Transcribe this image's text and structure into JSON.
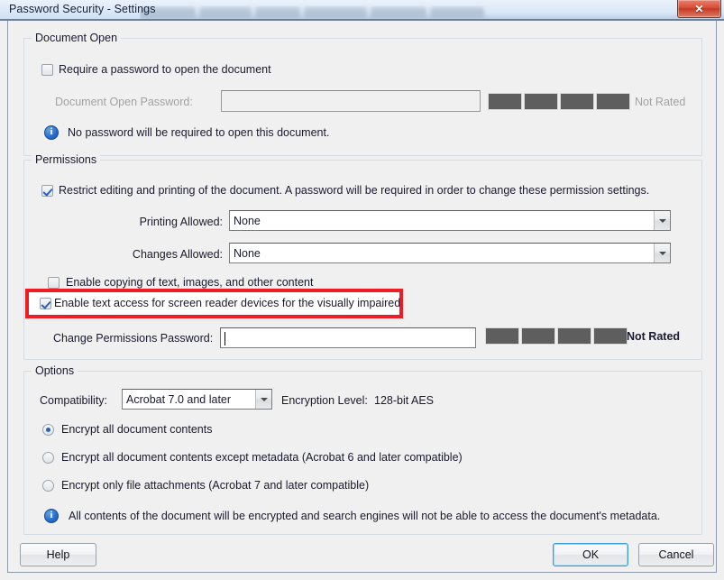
{
  "window": {
    "title": "Password Security - Settings",
    "close_label": "✕",
    "close_icon": "close-icon"
  },
  "document_open": {
    "group_title": "Document Open",
    "require_password_label": "Require a password to open the document",
    "require_password_checked": false,
    "password_field_label": "Document Open Password:",
    "password_field_value": "",
    "password_field_disabled": true,
    "strength_label": "Not Rated",
    "strength_segments": 4,
    "info_icon": "info-icon",
    "info_text": "No password will be required to open this document."
  },
  "permissions": {
    "group_title": "Permissions",
    "restrict_label": "Restrict editing and printing of the document. A password will be required in order to change these permission settings.",
    "restrict_checked": true,
    "printing_label": "Printing Allowed:",
    "printing_value": "None",
    "changes_label": "Changes Allowed:",
    "changes_value": "None",
    "enable_copy_label": "Enable copying of text, images, and other content",
    "enable_copy_checked": false,
    "screen_reader_label": "Enable text access for screen reader devices for the visually impaired",
    "screen_reader_checked": true,
    "change_password_label": "Change Permissions Password:",
    "change_password_value": "",
    "strength_label": "Not Rated",
    "strength_segments": 4
  },
  "options": {
    "group_title": "Options",
    "compatibility_label": "Compatibility:",
    "compatibility_value": "Acrobat 7.0 and later",
    "encryption_level_label": "Encryption Level:",
    "encryption_level_value": "128-bit AES",
    "radio_all_contents": "Encrypt all document contents",
    "radio_except_metadata": "Encrypt all document contents except metadata (Acrobat 6 and later compatible)",
    "radio_only_attachments": "Encrypt only file attachments (Acrobat 7 and later compatible)",
    "selected_radio": "all_contents",
    "info_icon": "info-icon",
    "info_text": "All contents of the document will be encrypted and search engines will not be able to access the document's metadata."
  },
  "footer": {
    "help_label": "Help",
    "ok_label": "OK",
    "cancel_label": "Cancel"
  },
  "colors": {
    "accent_red": "#ee1c24",
    "panel": "#f0f0f0",
    "titlebar": "#dce9f7",
    "close_red": "#c53a22",
    "check_blue": "#2a62b8",
    "meter_gray": "#5e5e5e"
  }
}
